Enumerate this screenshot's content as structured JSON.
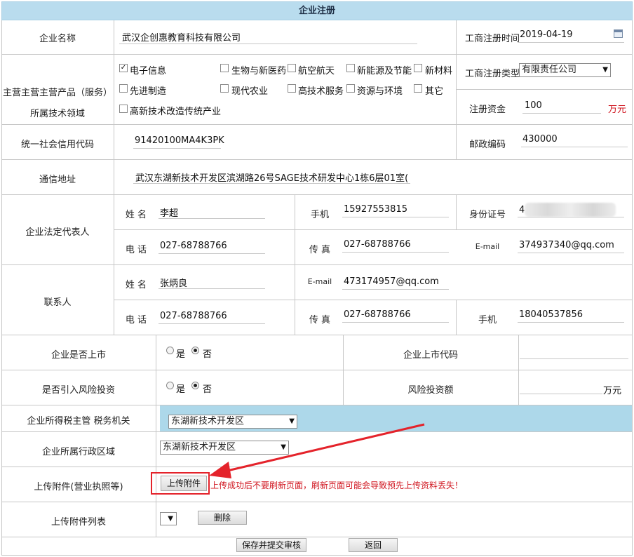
{
  "header": {
    "title": "企业注册"
  },
  "company_name": {
    "label": "企业名称",
    "value": "武汉企创惠教育科技有限公司"
  },
  "reg_date": {
    "label": "工商注册时间",
    "value": "2019-04-19"
  },
  "domain": {
    "label": "主营主营主营产品（服务）所属技术领域",
    "options": [
      {
        "label": "电子信息",
        "checked": true
      },
      {
        "label": "生物与新医药",
        "checked": false
      },
      {
        "label": "航空航天",
        "checked": false
      },
      {
        "label": "新能源及节能",
        "checked": false
      },
      {
        "label": "新材料",
        "checked": false
      },
      {
        "label": "先进制造",
        "checked": false
      },
      {
        "label": "现代农业",
        "checked": false
      },
      {
        "label": "高技术服务",
        "checked": false
      },
      {
        "label": "资源与环境",
        "checked": false
      },
      {
        "label": "其它",
        "checked": false
      },
      {
        "label": "高新技术改造传统产业",
        "checked": false
      }
    ]
  },
  "reg_type": {
    "label": "工商注册类型",
    "value": "有限责任公司"
  },
  "capital": {
    "label": "注册资金",
    "value": "100",
    "unit": "万元"
  },
  "credit_code": {
    "label": "统一社会信用代码",
    "value": "91420100MA4K3PK"
  },
  "postcode": {
    "label": "邮政编码",
    "value": "430000"
  },
  "address": {
    "label": "通信地址",
    "value": "武汉东湖新技术开发区滨湖路26号SAGE技术研发中心1栋6层01室("
  },
  "legal": {
    "label": "企业法定代表人",
    "name_label": "姓 名",
    "name": "李超",
    "mobile_label": "手机",
    "mobile": "15927553815",
    "id_label": "身份证号",
    "id_prefix": "4",
    "phone_label": "电 话",
    "phone": "027-68788766",
    "fax_label": "传 真",
    "fax": "027-68788766",
    "email_label": "E-mail",
    "email": "374937340@qq.com"
  },
  "contact": {
    "label": "联系人",
    "name_label": "姓 名",
    "name": "张炳良",
    "email_label": "E-mail",
    "email": "473174957@qq.com",
    "phone_label": "电 话",
    "phone": "027-68788766",
    "fax_label": "传 真",
    "fax": "027-68788766",
    "mobile_label": "手机",
    "mobile": "18040537856"
  },
  "listed": {
    "label": "企业是否上市",
    "yes": "是",
    "no": "否",
    "code_label": "企业上市代码"
  },
  "venture": {
    "label": "是否引入风险投资",
    "yes": "是",
    "no": "否",
    "amount_label": "风险投资额",
    "unit": "万元"
  },
  "tax": {
    "label": "企业所得税主管 税务机关",
    "value": "东湖新技术开发区"
  },
  "district": {
    "label": "企业所属行政区域",
    "value": "东湖新技术开发区"
  },
  "upload": {
    "label": "上传附件(营业执照等)",
    "button": "上传附件",
    "warning": "上传成功后不要刷新页面，刷新页面可能会导致预先上传资料丢失！"
  },
  "attachments": {
    "label": "上传附件列表",
    "delete": "删除"
  },
  "actions": {
    "submit": "保存并提交审核",
    "back": "返回"
  }
}
